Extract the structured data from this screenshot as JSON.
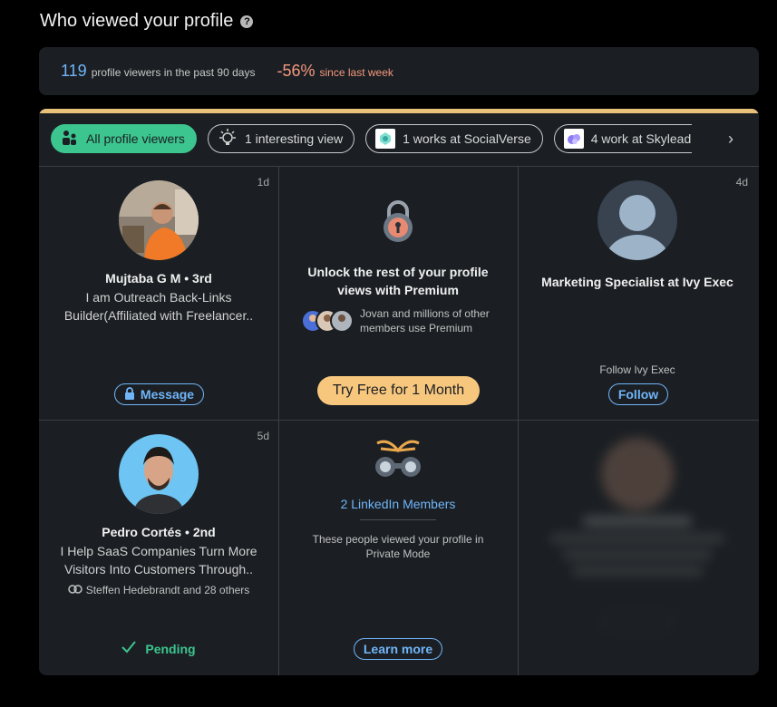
{
  "header": {
    "title": "Who viewed your profile",
    "help_icon": "question-circle-icon"
  },
  "stats": {
    "viewers_count": "119",
    "viewers_label": "profile viewers in the past 90 days",
    "change_value": "-56%",
    "change_label": "since last week"
  },
  "filters": [
    {
      "label": "All profile viewers",
      "icon": "people-icon",
      "active": true
    },
    {
      "label": "1 interesting view",
      "icon": "lightbulb-icon",
      "active": false
    },
    {
      "label": "1 works at SocialVerse",
      "icon": "socialverse-logo",
      "active": false
    },
    {
      "label": "4 work at Skylead",
      "icon": "skylead-logo",
      "active": false
    }
  ],
  "viewers": {
    "mujtaba": {
      "time": "1d",
      "name": "Mujtaba G M • 3rd",
      "headline_1": "I am Outreach Back-Links",
      "headline_2": "Builder(Affiliated with Freelancer..",
      "button": "Message"
    },
    "premium": {
      "title_1": "Unlock the rest of your profile",
      "title_2": "views with Premium",
      "sub_1": "Jovan and millions of other",
      "sub_2": "members use Premium",
      "button": "Try Free for 1 Month"
    },
    "anonymous": {
      "time": "4d",
      "title": "Marketing Specialist at Ivy Exec",
      "follow_label": "Follow Ivy Exec",
      "button": "Follow"
    },
    "pedro": {
      "time": "5d",
      "name": "Pedro Cortés • 2nd",
      "headline_1": "I Help SaaS Companies Turn More",
      "headline_2": "Visitors Into Customers Through..",
      "mutual": "Steffen Hedebrandt and 28 others",
      "status": "Pending"
    },
    "private": {
      "title": "2 LinkedIn Members",
      "sub_1": "These people viewed your profile in",
      "sub_2": "Private Mode",
      "button": "Learn more"
    }
  },
  "colors": {
    "accent_blue": "#70b5f9",
    "accent_green": "#3cc58e",
    "premium_gold": "#f8c77e",
    "negative": "#f5987e"
  }
}
